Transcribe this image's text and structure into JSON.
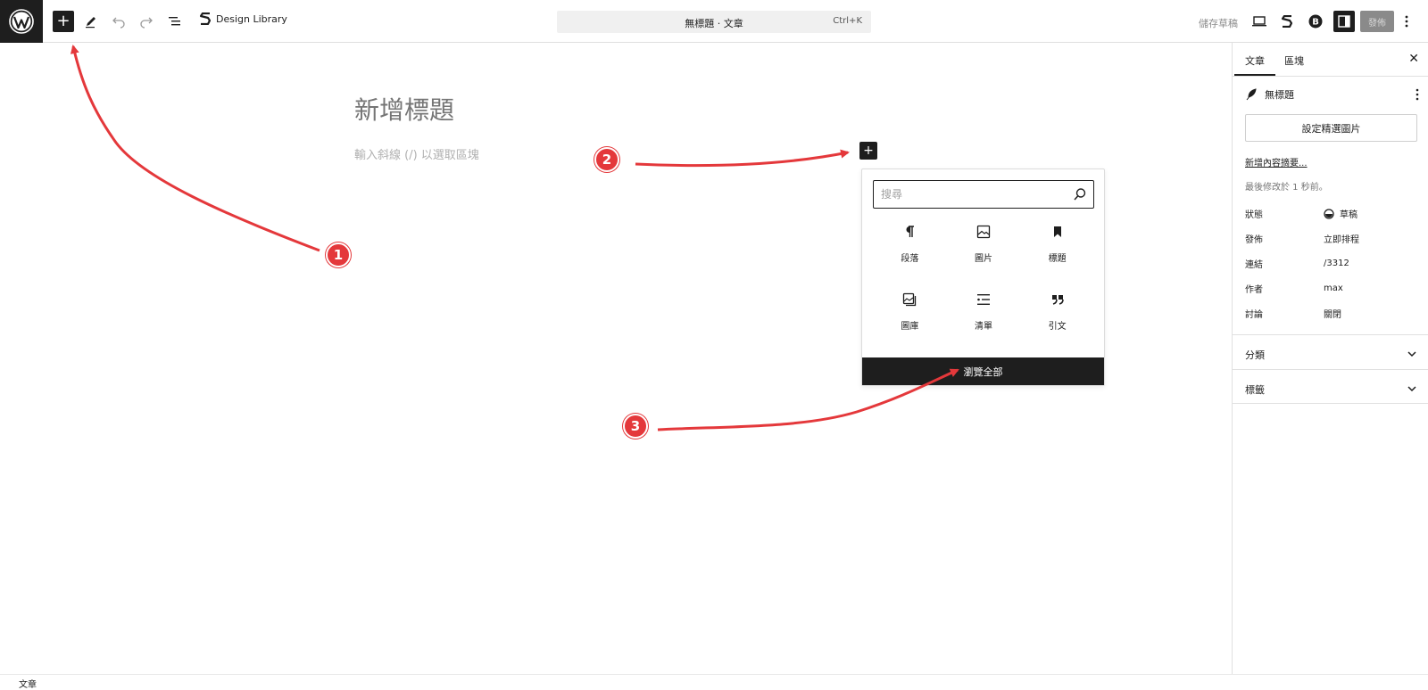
{
  "topbar": {
    "design_library_label": "Design Library",
    "document_title": "無標題 · 文章",
    "shortcut": "Ctrl+K",
    "save_draft_label": "儲存草稿",
    "publish_label": "發佈"
  },
  "editor": {
    "title_placeholder": "新增標題",
    "block_placeholder": "輸入斜線 (/) 以選取區塊"
  },
  "inserter": {
    "search_placeholder": "搜尋",
    "blocks": [
      {
        "label": "段落",
        "icon": "paragraph-icon"
      },
      {
        "label": "圖片",
        "icon": "image-icon"
      },
      {
        "label": "標題",
        "icon": "heading-bookmark-icon"
      },
      {
        "label": "圖庫",
        "icon": "gallery-icon"
      },
      {
        "label": "清單",
        "icon": "list-icon"
      },
      {
        "label": "引文",
        "icon": "quote-icon"
      }
    ],
    "browse_all_label": "瀏覽全部"
  },
  "sidebar": {
    "tabs": [
      "文章",
      "區塊"
    ],
    "post_title": "無標題",
    "featured_image_label": "設定精選圖片",
    "excerpt_link": "新增內容摘要...",
    "last_modified": "最後修改於 1 秒前。",
    "meta": [
      {
        "key": "狀態",
        "value": "草稿"
      },
      {
        "key": "發佈",
        "value": "立即排程"
      },
      {
        "key": "連結",
        "value": "/3312"
      },
      {
        "key": "作者",
        "value": "max"
      },
      {
        "key": "討論",
        "value": "關閉"
      }
    ],
    "panels": [
      "分類",
      "標籤"
    ]
  },
  "footer": {
    "breadcrumb": "文章"
  },
  "annotations": {
    "badges": [
      "1",
      "2",
      "3"
    ],
    "color": "#e4383b"
  }
}
